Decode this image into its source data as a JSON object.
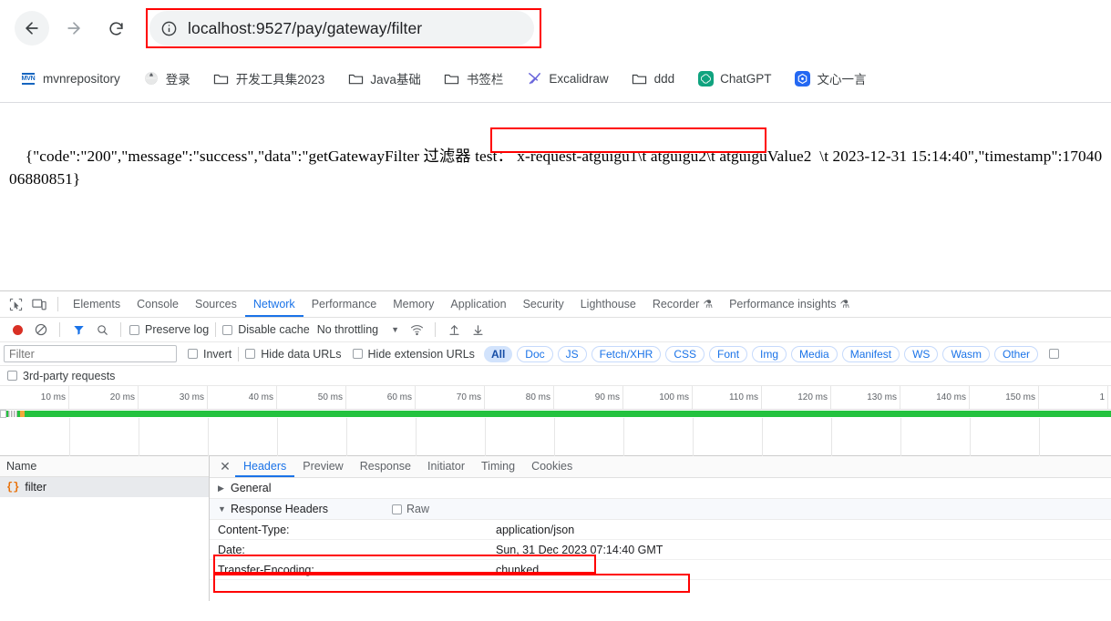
{
  "browser": {
    "nav": {
      "back_label": "Back",
      "forward_label": "Forward",
      "reload_label": "Reload"
    },
    "omnibox": {
      "site_info_icon": "info-circle-icon",
      "url_prefix": "localhost:9527",
      "url_path": "/pay/gateway/filter",
      "url_full": "localhost:9527/pay/gateway/filter"
    },
    "bookmarks": [
      {
        "label": "mvnrepository",
        "icon": "mvn-icon",
        "icon_text": "MVN"
      },
      {
        "label": "登录",
        "icon": "globe-icon"
      },
      {
        "label": "开发工具集2023",
        "icon": "folder-icon"
      },
      {
        "label": "Java基础",
        "icon": "folder-icon"
      },
      {
        "label": "书签栏",
        "icon": "folder-icon"
      },
      {
        "label": "Excalidraw",
        "icon": "excalidraw-icon"
      },
      {
        "label": "ddd",
        "icon": "folder-icon"
      },
      {
        "label": "ChatGPT",
        "icon": "chatgpt-icon"
      },
      {
        "label": "文心一言",
        "icon": "wenxin-icon"
      }
    ]
  },
  "page": {
    "response_part1": "{\"code\":\"200\",\"message\":\"success\",\"data\":",
    "response_highlight": "\"getGatewayFilter 过滤器 test：",
    "response_part2": " x-request-atguigu1\\t atguigu2\\t atguiguValue2  \\t 2023-12-31 15:14:40\",\"timestamp\":1704006880851}",
    "full_text": "{\"code\":\"200\",\"message\":\"success\",\"data\":\"getGatewayFilter 过滤器 test： x-request-atguigu1\\t atguigu2\\t atguiguValue2  \\t 2023-12-31 15:14:40\",\"timestamp\":1704006880851}"
  },
  "devtools": {
    "left_icons": [
      {
        "name": "inspect-element-icon"
      },
      {
        "name": "device-toolbar-icon"
      }
    ],
    "tabs": [
      {
        "label": "Elements",
        "active": false
      },
      {
        "label": "Console",
        "active": false
      },
      {
        "label": "Sources",
        "active": false
      },
      {
        "label": "Network",
        "active": true
      },
      {
        "label": "Performance",
        "active": false
      },
      {
        "label": "Memory",
        "active": false
      },
      {
        "label": "Application",
        "active": false
      },
      {
        "label": "Security",
        "active": false
      },
      {
        "label": "Lighthouse",
        "active": false
      },
      {
        "label": "Recorder",
        "active": false,
        "flask": "⚗"
      },
      {
        "label": "Performance insights",
        "active": false,
        "flask": "⚗"
      }
    ],
    "toolbar": {
      "record_label": "Record network log",
      "clear_label": "Clear",
      "filter_label": "Filter",
      "search_label": "Search",
      "preserve_log": "Preserve log",
      "preserve_log_checked": false,
      "disable_cache": "Disable cache",
      "disable_cache_checked": false,
      "throttling": "No throttling",
      "wifi_icon": "wifi-icon",
      "import_label": "Import HAR",
      "export_label": "Export HAR"
    },
    "filterbar": {
      "filter_placeholder": "Filter",
      "filter_value": "",
      "invert": "Invert",
      "hide_data_urls": "Hide data URLs",
      "hide_extension_urls": "Hide extension URLs",
      "types": [
        "All",
        "Doc",
        "JS",
        "Fetch/XHR",
        "CSS",
        "Font",
        "Img",
        "Media",
        "Manifest",
        "WS",
        "Wasm",
        "Other"
      ],
      "active_type": "All",
      "blocked_cookies_checkbox": ""
    },
    "third_party": "3rd-party requests",
    "timeline_ticks": [
      "10 ms",
      "20 ms",
      "30 ms",
      "40 ms",
      "50 ms",
      "60 ms",
      "70 ms",
      "80 ms",
      "90 ms",
      "100 ms",
      "110 ms",
      "120 ms",
      "130 ms",
      "140 ms",
      "150 ms",
      "1"
    ],
    "requests": {
      "column_header": "Name",
      "rows": [
        {
          "name": "filter",
          "icon": "json-icon",
          "selected": true
        }
      ]
    },
    "detail": {
      "close_icon": "close-icon",
      "tabs": [
        {
          "label": "Headers",
          "active": true
        },
        {
          "label": "Preview",
          "active": false
        },
        {
          "label": "Response",
          "active": false
        },
        {
          "label": "Initiator",
          "active": false
        },
        {
          "label": "Timing",
          "active": false
        },
        {
          "label": "Cookies",
          "active": false
        }
      ],
      "sections": [
        {
          "title": "General",
          "expanded": false
        },
        {
          "title": "Response Headers",
          "expanded": true,
          "raw_label": "Raw",
          "raw_checked": false
        }
      ],
      "response_headers": [
        {
          "name": "Content-Type:",
          "value": "application/json",
          "highlighted": true
        },
        {
          "name": "Date:",
          "value": "Sun, 31 Dec 2023 07:14:40 GMT",
          "highlighted": true
        },
        {
          "name": "Transfer-Encoding:",
          "value": "chunked",
          "highlighted": false
        }
      ]
    }
  },
  "annotations": {
    "highlight_color": "#ff0000",
    "boxes": [
      "url-bar",
      "response-data-snippet",
      "content-type-header",
      "date-header"
    ]
  }
}
